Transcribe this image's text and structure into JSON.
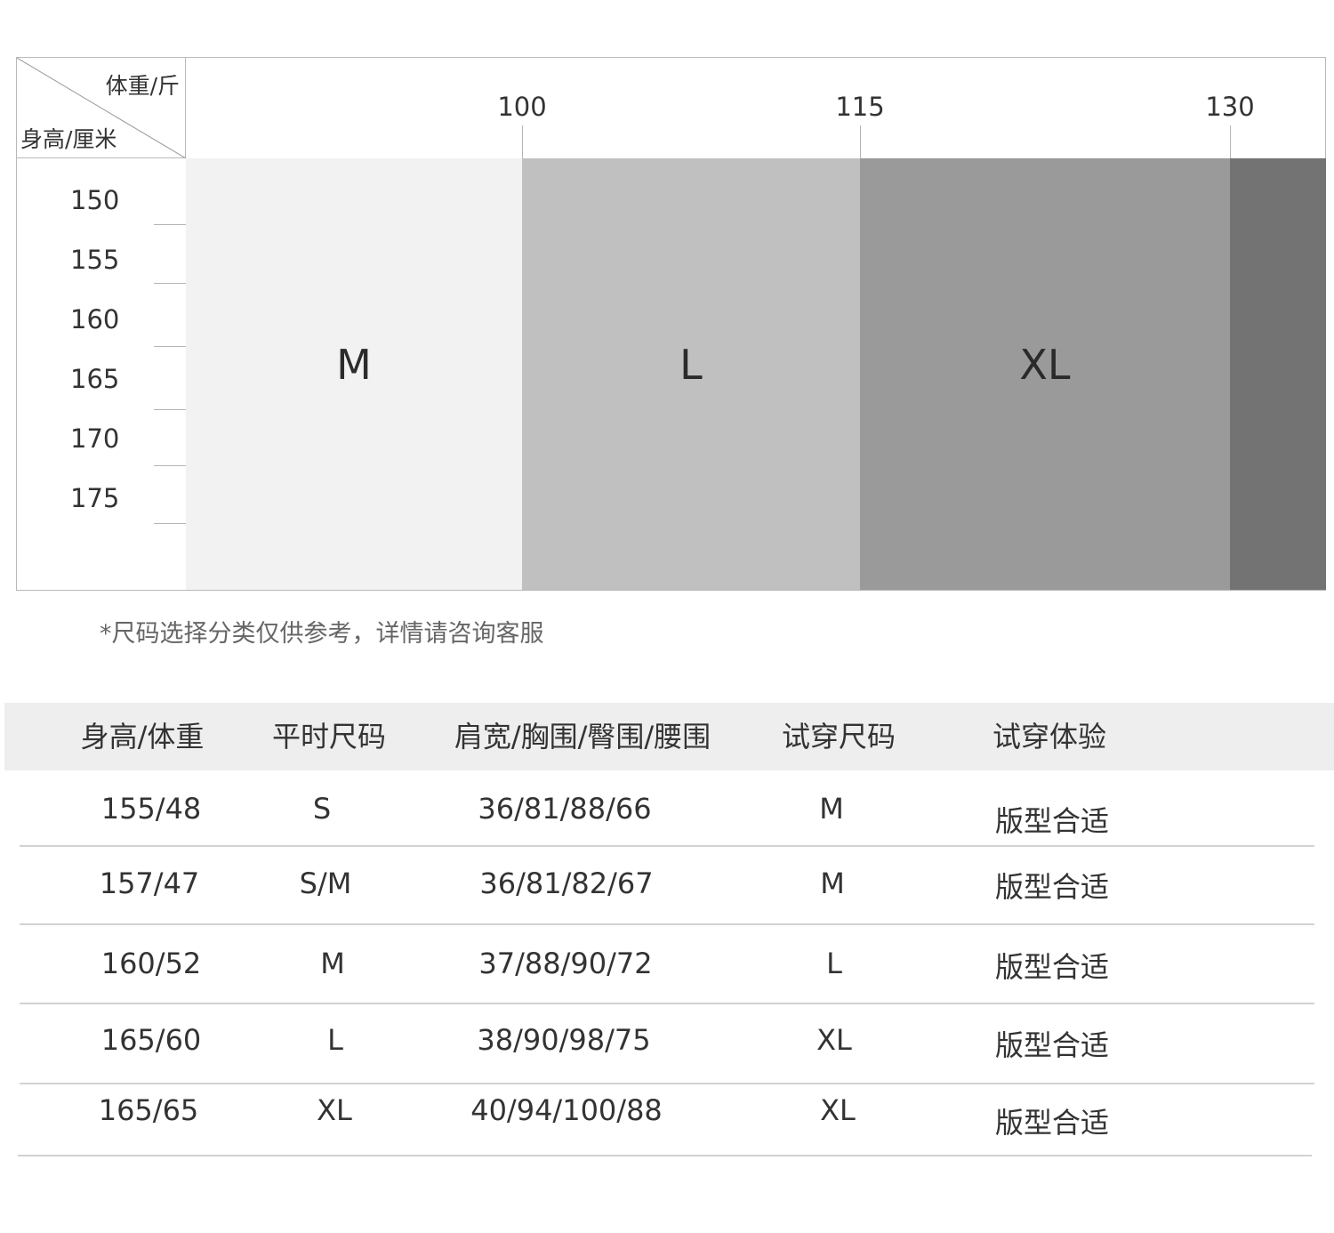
{
  "chart": {
    "corner_weight_label": "体重/斤",
    "corner_height_label": "身高/厘米",
    "weight_ticks": [
      "100",
      "115",
      "130"
    ],
    "height_ticks": [
      "150",
      "155",
      "160",
      "165",
      "170",
      "175"
    ],
    "bands": [
      {
        "label": "M",
        "color": "#f2f2f2"
      },
      {
        "label": "L",
        "color": "#c0c0c0"
      },
      {
        "label": "XL",
        "color": "#9a9a9a"
      },
      {
        "label": "",
        "color": "#737373"
      }
    ]
  },
  "note": "*尺码选择分类仅供参考，详情请咨询客服",
  "table": {
    "headers": [
      "身高/体重",
      "平时尺码",
      "肩宽/胸围/臀围/腰围",
      "试穿尺码",
      "试穿体验"
    ],
    "rows": [
      [
        "155/48",
        "S",
        "36/81/88/66",
        "M",
        "版型合适"
      ],
      [
        "157/47",
        "S/M",
        "36/81/82/67",
        "M",
        "版型合适"
      ],
      [
        "160/52",
        "M",
        "37/88/90/72",
        "L",
        "版型合适"
      ],
      [
        "165/60",
        "L",
        "38/90/98/75",
        "XL",
        "版型合适"
      ],
      [
        "165/65",
        "XL",
        "40/94/100/88",
        "XL",
        "版型合适"
      ]
    ]
  }
}
